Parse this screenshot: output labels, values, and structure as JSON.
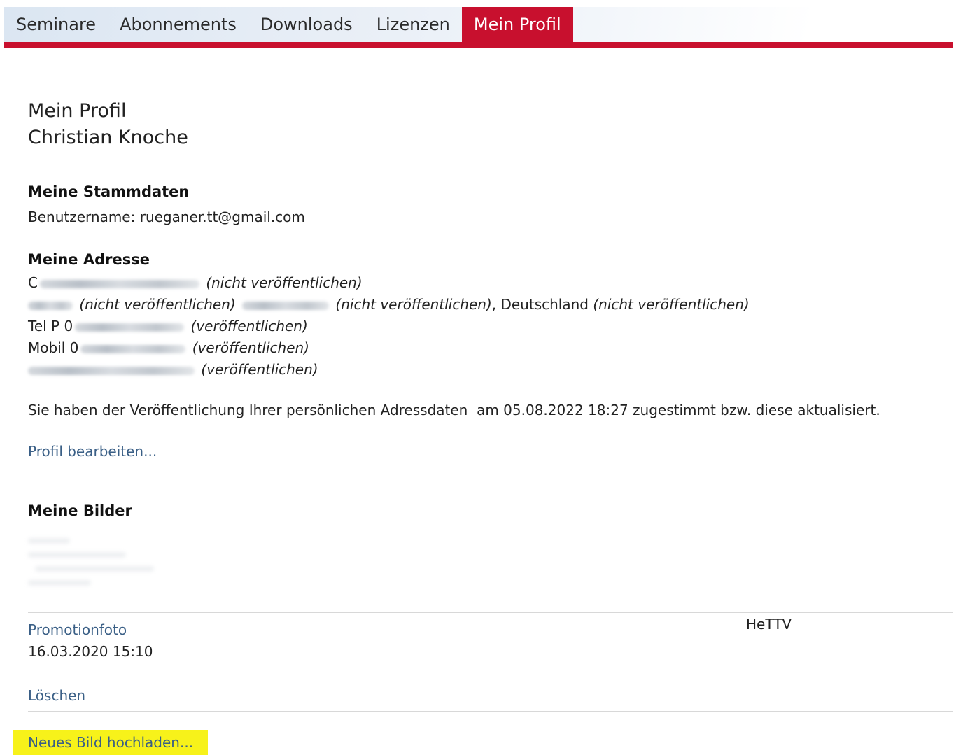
{
  "nav": {
    "tabs": [
      {
        "label": "Seminare",
        "active": false
      },
      {
        "label": "Abonnements",
        "active": false
      },
      {
        "label": "Downloads",
        "active": false
      },
      {
        "label": "Lizenzen",
        "active": false
      },
      {
        "label": "Mein Profil",
        "active": true
      }
    ],
    "accent_color": "#c8102e"
  },
  "profile": {
    "title": "Mein Profil",
    "name": "Christian Knoche"
  },
  "stammdaten": {
    "heading": "Meine Stammdaten",
    "username_label": "Benutzername:",
    "username_value": "rueganer.tt@gmail.com"
  },
  "address": {
    "heading": "Meine Adresse",
    "street_start": "C",
    "not_public": "(nicht veröffentlichen)",
    "public": "(veröffentlichen)",
    "country": ", Deutschland",
    "phone_label": "Tel P 0",
    "mobile_label": "Mobil 0"
  },
  "consent": {
    "text": "Sie haben der Veröffentlichung Ihrer persönlichen Adressdaten  am 05.08.2022 18:27 zugestimmt bzw. diese aktualisiert."
  },
  "edit_link": "Profil bearbeiten...",
  "images": {
    "heading": "Meine Bilder",
    "item": {
      "type": "Promotionfoto",
      "date": "16.03.2020 15:10",
      "org": "HeTTV",
      "delete": "Löschen"
    },
    "upload": "Neues Bild hochladen..."
  },
  "highlight_color": "#f7f21a"
}
